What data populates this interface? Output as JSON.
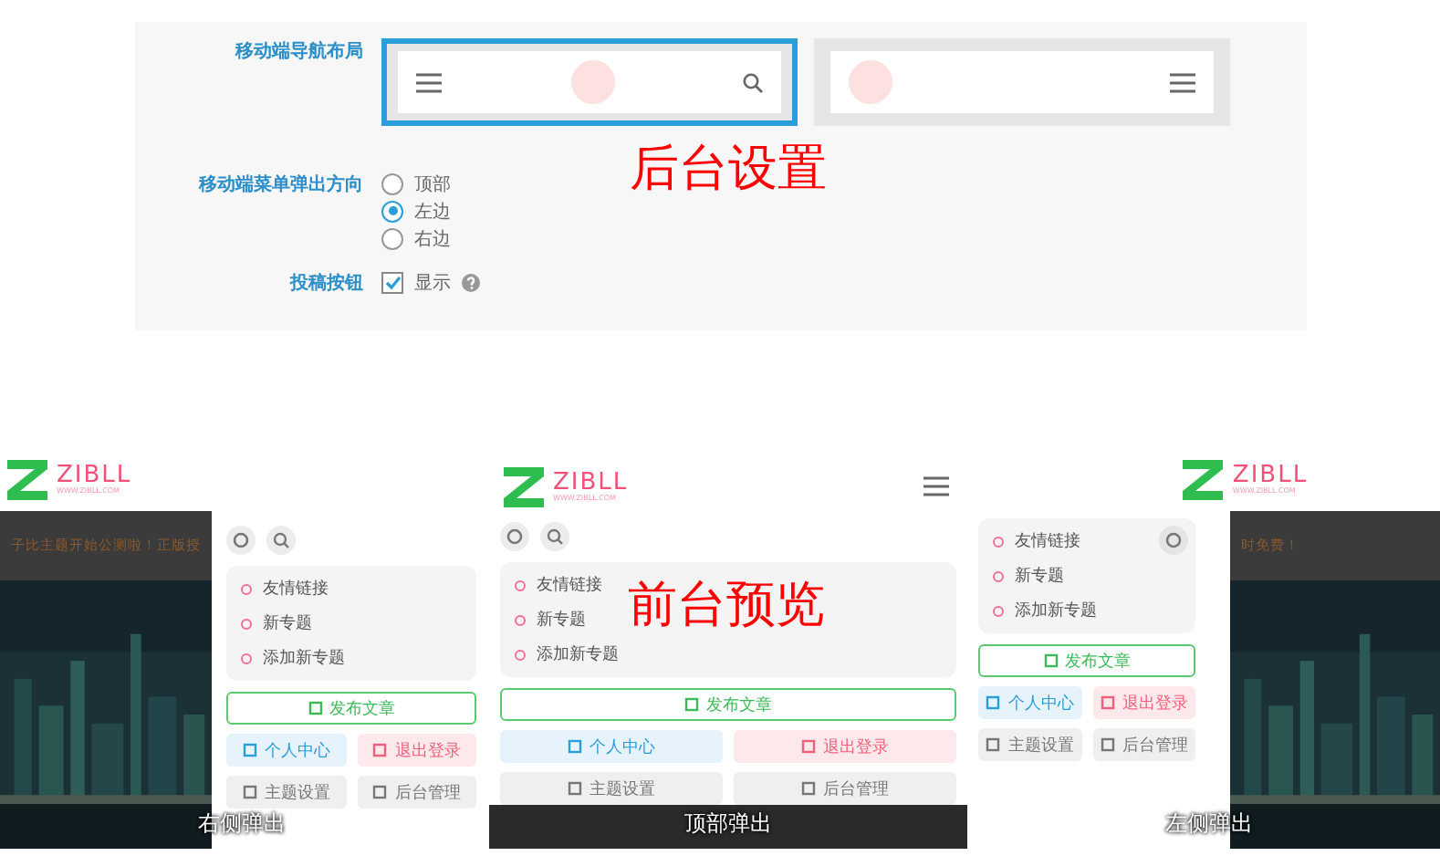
{
  "settings": {
    "annotation": "后台设置",
    "nav_layout": {
      "label": "移动端导航布局",
      "options": [
        {
          "kind": "menu-left",
          "selected": true
        },
        {
          "kind": "menu-right",
          "selected": false
        }
      ]
    },
    "popup_direction": {
      "label": "移动端菜单弹出方向",
      "options": [
        {
          "label": "顶部",
          "selected": false
        },
        {
          "label": "左边",
          "selected": true
        },
        {
          "label": "右边",
          "selected": false
        }
      ]
    },
    "submit_button": {
      "label": "投稿按钮",
      "checked": true,
      "option": "显示"
    }
  },
  "preview": {
    "annotation": "前台预览",
    "panels": [
      {
        "kind": "right",
        "caption": "右侧弹出",
        "logo": "ZIBLL",
        "logo_sub": "WWW.ZIBLL.COM",
        "notice": "子比主题开始公测啦！正版授",
        "menu": [
          "友情链接",
          "新专题",
          "添加新专题"
        ],
        "buttons": [
          {
            "kind": "publish",
            "label": "发布文章"
          },
          {
            "kind": "user",
            "label": "个人中心"
          },
          {
            "kind": "logout",
            "label": "退出登录"
          },
          {
            "kind": "plain",
            "label": "主题设置"
          },
          {
            "kind": "plain",
            "label": "后台管理"
          }
        ]
      },
      {
        "kind": "top",
        "caption": "顶部弹出",
        "logo": "ZIBLL",
        "logo_sub": "WWW.ZIBLL.COM",
        "menu": [
          "友情链接",
          "新专题",
          "添加新专题"
        ],
        "buttons": [
          {
            "kind": "publish",
            "label": "发布文章"
          },
          {
            "kind": "user",
            "label": "个人中心"
          },
          {
            "kind": "logout",
            "label": "退出登录"
          },
          {
            "kind": "plain",
            "label": "主题设置"
          },
          {
            "kind": "plain",
            "label": "后台管理"
          }
        ]
      },
      {
        "kind": "left",
        "caption": "左侧弹出",
        "logo": "ZIBLL",
        "logo_sub": "WWW.ZIBLL.COM",
        "notice": "时免费！",
        "menu": [
          "友情链接",
          "新专题",
          "添加新专题"
        ],
        "buttons": [
          {
            "kind": "publish",
            "label": "发布文章"
          },
          {
            "kind": "user",
            "label": "个人中心"
          },
          {
            "kind": "logout",
            "label": "退出登录"
          },
          {
            "kind": "plain",
            "label": "主题设置"
          },
          {
            "kind": "plain",
            "label": "后台管理"
          }
        ]
      }
    ]
  }
}
